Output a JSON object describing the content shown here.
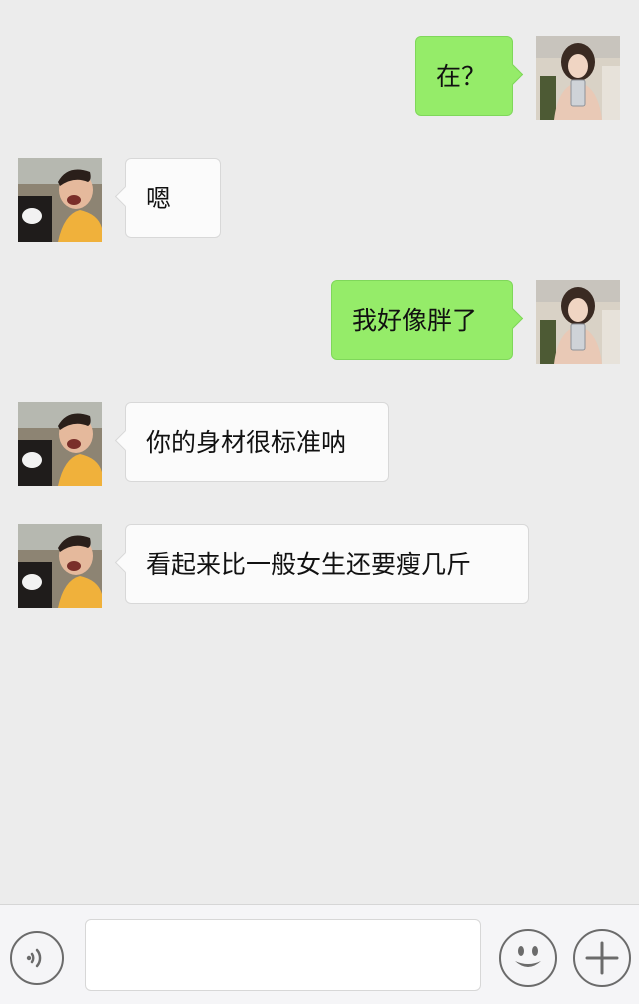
{
  "chat": {
    "messages": [
      {
        "side": "out",
        "sender": "self",
        "text": "在？"
      },
      {
        "side": "in",
        "sender": "contact",
        "text": "嗯"
      },
      {
        "side": "out",
        "sender": "self",
        "text": "我好像胖了"
      },
      {
        "side": "in",
        "sender": "contact",
        "text": "你的身材很标准呐"
      },
      {
        "side": "in",
        "sender": "contact",
        "text": "看起来比一般女生还要瘦几斤"
      }
    ]
  },
  "input_bar": {
    "voice_icon": "voice-icon",
    "emoji_icon": "emoji-icon",
    "plus_icon": "plus-icon",
    "message_value": "",
    "colors": {
      "icon_stroke": "#6b6b6b",
      "bar_bg": "#f5f5f7"
    }
  },
  "colors": {
    "chat_bg": "#ececec",
    "outgoing_bubble": "#95ec69",
    "incoming_bubble": "#fbfbfb"
  }
}
